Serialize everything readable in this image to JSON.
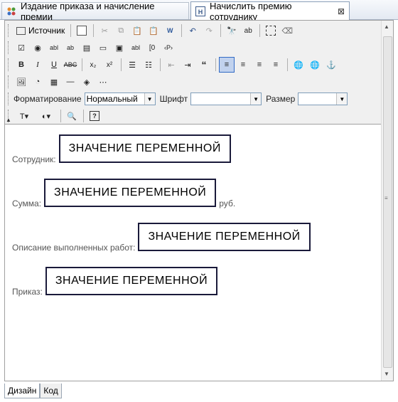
{
  "tabs": [
    {
      "label": "Издание приказа и начисление премии",
      "icon": "form-icon",
      "active": false
    },
    {
      "label": "Начислить премию сотруднику",
      "icon": "html-document-icon",
      "active": true
    }
  ],
  "toolbar": {
    "source_label": "Источник",
    "format_label": "Форматирование",
    "format_value": "Нормальный",
    "font_label": "Шрифт",
    "font_value": "",
    "size_label": "Размер",
    "size_value": ""
  },
  "content": {
    "fields": [
      {
        "label": "Сотрудник:",
        "value": "ЗНАЧЕНИЕ ПЕРЕМЕННОЙ",
        "suffix": ""
      },
      {
        "label": "Сумма:",
        "value": "ЗНАЧЕНИЕ ПЕРЕМЕННОЙ",
        "suffix": "руб."
      },
      {
        "label": "Описание выполненных работ:",
        "value": "ЗНАЧЕНИЕ ПЕРЕМЕННОЙ",
        "suffix": ""
      },
      {
        "label": "Приказ:",
        "value": "ЗНАЧЕНИЕ ПЕРЕМЕННОЙ",
        "suffix": ""
      }
    ]
  },
  "bottom_tabs": [
    {
      "label": "Дизайн",
      "active": true
    },
    {
      "label": "Код",
      "active": false
    }
  ],
  "colors": {
    "accent": "#316ac5",
    "varbox_border": "#1a1a3a",
    "label_text": "#555555"
  }
}
